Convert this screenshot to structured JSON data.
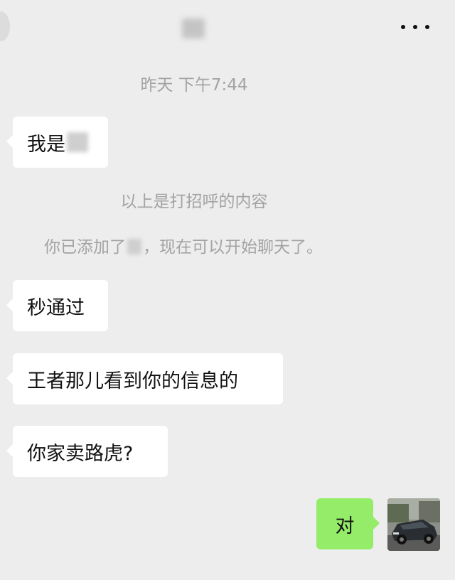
{
  "header": {
    "contact_name": "",
    "more_icon": "more-dots-icon"
  },
  "system": {
    "timestamp": "昨天 下午7:44",
    "greeting_note": "以上是打招呼的内容",
    "added_prefix": "你已添加了",
    "added_suffix": "，现在可以开始聊天了。"
  },
  "messages": [
    {
      "side": "left",
      "text": "我是"
    },
    {
      "side": "left",
      "text": "秒通过"
    },
    {
      "side": "left",
      "text": "王者那儿看到你的信息的"
    },
    {
      "side": "left",
      "text": "你家卖路虎?"
    },
    {
      "side": "right",
      "text": "对"
    }
  ],
  "colors": {
    "background": "#ededed",
    "incoming_bubble": "#ffffff",
    "outgoing_bubble": "#95ec69",
    "system_text": "#a3a3a3"
  }
}
